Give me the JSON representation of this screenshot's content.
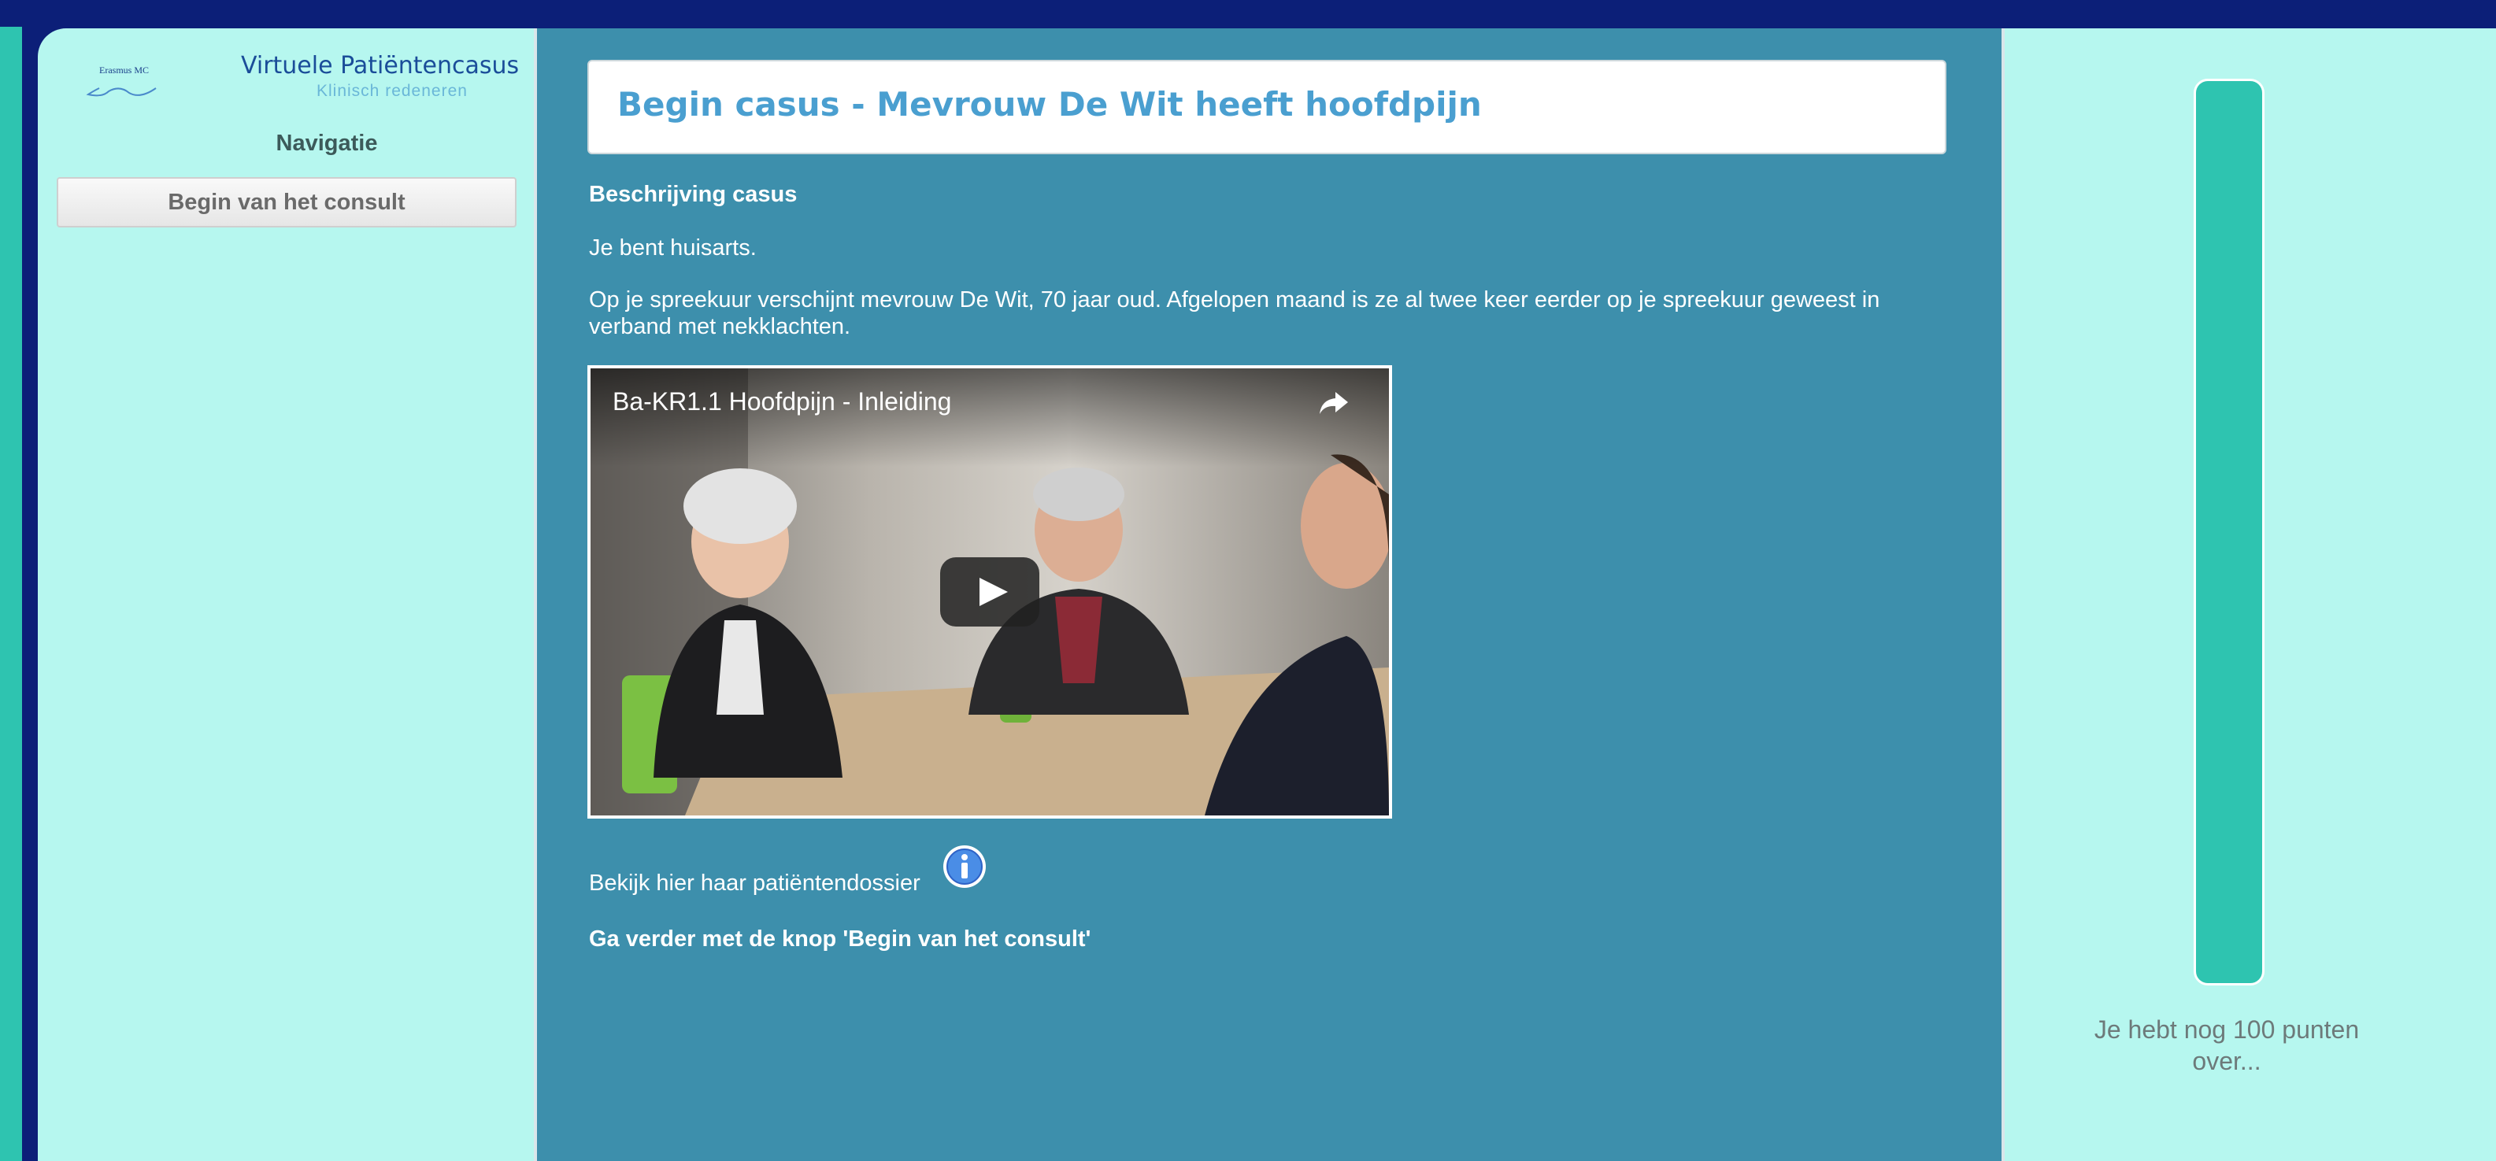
{
  "header": {
    "logo_text": "Erasmus MC",
    "app_title": "Virtuele Patiëntencasus",
    "app_subtitle": "Klinisch redeneren"
  },
  "sidebar": {
    "nav_heading": "Navigatie",
    "items": [
      {
        "label": "Begin van het consult"
      }
    ]
  },
  "main": {
    "case_title": "Begin casus - Mevrouw De Wit heeft hoofdpijn",
    "description_heading": "Beschrijving casus",
    "paragraphs": [
      "Je bent huisarts.",
      "Op je spreekuur verschijnt mevrouw De Wit, 70 jaar oud. Afgelopen maand is ze al twee keer eerder op je spreekuur geweest in verband met nekklachten."
    ],
    "video": {
      "title": "Ba-KR1.1 Hoofdpijn - Inleiding",
      "icons": [
        "share-icon",
        "play-icon"
      ]
    },
    "dossier_text": "Bekijk hier haar patiëntendossier",
    "dossier_icon": "info-icon",
    "continue_text": "Ga verder met de knop 'Begin van het consult'"
  },
  "score": {
    "text": "Je hebt nog 100 punten over...",
    "fill_fraction": 1.0
  },
  "colors": {
    "page_bg": "#0c1f78",
    "panel_bg": "#b6f7ef",
    "main_bg": "#3d8fac",
    "accent": "#2ec4b0",
    "title_color": "#4a9fd0"
  }
}
